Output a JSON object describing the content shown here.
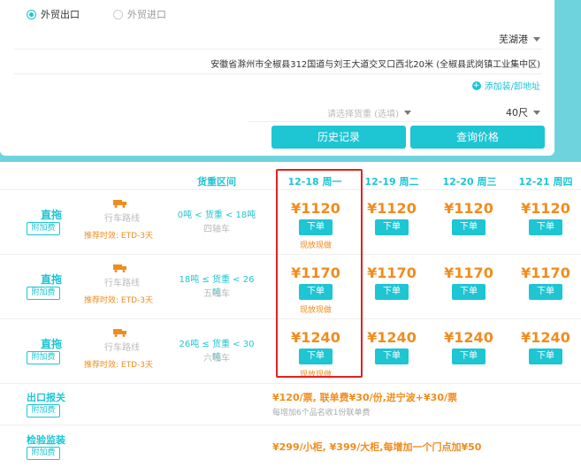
{
  "trade_options": [
    {
      "label": "外贸出口",
      "selected": true
    },
    {
      "label": "外贸进口",
      "selected": false
    }
  ],
  "port": {
    "value": "芜湖港"
  },
  "address": {
    "value": "安徽省滁州市全椒县312国道与刘王大道交叉口西北20米 (全椒县武岗镇工业集中区)"
  },
  "add_address_label": "添加装/卸地址",
  "cargo_select": {
    "placeholder": "请选择货重 (选填)"
  },
  "container_size": {
    "value": "40尺"
  },
  "buttons": {
    "history": "历史记录",
    "query": "查询价格"
  },
  "table": {
    "weight_header": "货重区间",
    "dates": [
      "12-18 周一",
      "12-19 周二",
      "12-20 周三",
      "12-21 周四"
    ],
    "rows": [
      {
        "type": "直拖",
        "fee": "附加费",
        "route": "行车路线",
        "eta": "推荐时效: ETD-3天",
        "weight": "0吨 < 货重 < 18吨",
        "axle": "四轴车",
        "prices": [
          "¥1120",
          "¥1120",
          "¥1120",
          "¥1120"
        ],
        "cash": "现放现做"
      },
      {
        "type": "直拖",
        "fee": "附加费",
        "route": "行车路线",
        "eta": "推荐时效: ETD-3天",
        "weight": "18吨 ≤ 货重 < 26吨",
        "axle": "五轴车",
        "prices": [
          "¥1170",
          "¥1170",
          "¥1170",
          "¥1170"
        ],
        "cash": "现放现做"
      },
      {
        "type": "直拖",
        "fee": "附加费",
        "route": "行车路线",
        "eta": "推荐时效: ETD-3天",
        "weight": "26吨 ≤ 货重 < 30吨",
        "axle": "六轴车",
        "prices": [
          "¥1240",
          "¥1240",
          "¥1240",
          "¥1240"
        ],
        "cash": "现放现做"
      }
    ],
    "order_label": "下单"
  },
  "customs": {
    "title": "出口报关",
    "fee": "附加费",
    "text": "¥120/票, 联单费¥30/份,进宁波+¥30/票",
    "note": "每增加6个品名收1份联单费"
  },
  "inspection": {
    "title": "检验监装",
    "fee": "附加费",
    "text": "¥299/小柜, ¥399/大柜,每增加一个门点加¥50"
  },
  "colors": {
    "accent": "#1ec5d3",
    "price": "#f08c1e",
    "highlight": "#e62020"
  }
}
